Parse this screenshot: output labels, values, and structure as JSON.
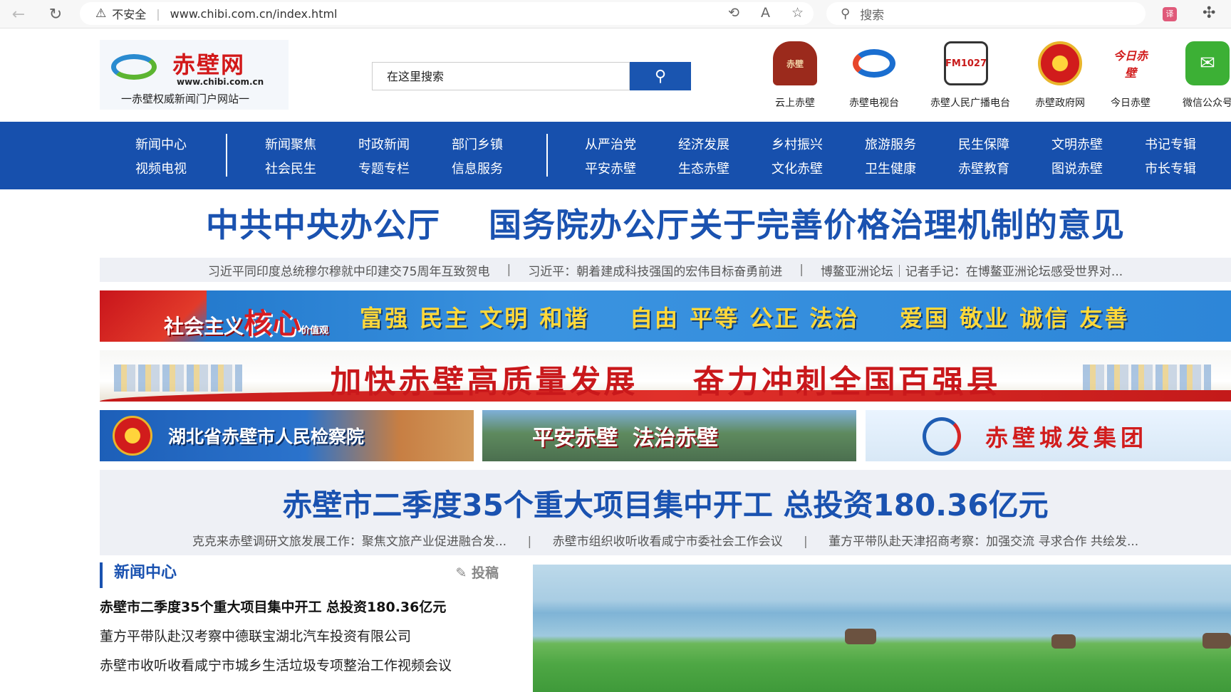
{
  "browser": {
    "security_label": "不安全",
    "url": "www.chibi.com.cn/index.html",
    "search_placeholder": "搜索"
  },
  "header": {
    "brand": "赤壁网",
    "domain": "www.chibi.com.cn",
    "slogan": "一赤壁权威新闻门户网站一",
    "search_placeholder": "在这里搜索",
    "quick_links": [
      {
        "label": "云上赤壁",
        "icon": "cloud-chibi-icon"
      },
      {
        "label": "赤壁电视台",
        "icon": "tv-station-icon"
      },
      {
        "label": "赤壁人民广播电台",
        "icon": "radio-fm1027-icon"
      },
      {
        "label": "赤壁政府网",
        "icon": "national-emblem-icon"
      },
      {
        "label": "今日赤壁",
        "icon": "today-chibi-icon"
      },
      {
        "label": "微信公众号",
        "icon": "wechat-icon"
      }
    ]
  },
  "nav": {
    "groups": [
      [
        [
          "新闻中心",
          "视频电视"
        ]
      ],
      [
        [
          "新闻聚焦",
          "社会民生"
        ],
        [
          "时政新闻",
          "专题专栏"
        ],
        [
          "部门乡镇",
          "信息服务"
        ]
      ],
      [
        [
          "从严治党",
          "平安赤壁"
        ],
        [
          "经济发展",
          "生态赤壁"
        ],
        [
          "乡村振兴",
          "文化赤壁"
        ],
        [
          "旅游服务",
          "卫生健康"
        ],
        [
          "民生保障",
          "赤壁教育"
        ],
        [
          "文明赤壁",
          "图说赤壁"
        ],
        [
          "书记专辑",
          "市长专辑"
        ]
      ]
    ]
  },
  "headline": {
    "title": "中共中央办公厅    国务院办公厅关于完善价格治理机制的意见",
    "links": [
      "习近平同印度总统穆尔穆就中印建交75周年互致贺电",
      "习近平：朝着建成科技强国的宏伟目标奋勇前进",
      "博鳌亚洲论坛｜记者手记：在博鳌亚洲论坛感受世界对..."
    ]
  },
  "banners": {
    "values_left": "社会主义",
    "values_core": "核心",
    "values_small": "价值观",
    "values_main": "富强 民主 文明 和谐    自由 平等 公正 法治    爱国 敬业 诚信 友善",
    "development": "加快赤壁高质量发展    奋力冲刺全国百强县",
    "ads": [
      "湖北省赤壁市人民检察院",
      "平安赤壁  法治赤壁",
      "赤壁城发集团"
    ]
  },
  "feature": {
    "title": "赤壁市二季度35个重大项目集中开工 总投资180.36亿元",
    "links": [
      "克克来赤壁调研文旅发展工作：聚焦文旅产业促进融合发...",
      "赤壁市组织收听收看咸宁市委社会工作会议",
      "董方平带队赴天津招商考察：加强交流 寻求合作 共绘发..."
    ]
  },
  "news": {
    "heading": "新闻中心",
    "submit_label": "投稿",
    "items": [
      "赤壁市二季度35个重大项目集中开工 总投资180.36亿元",
      "董方平带队赴汉考察中德联宝湖北汽车投资有限公司",
      "赤壁市收听收看咸宁市城乡生活垃圾专项整治工作视频会议"
    ]
  },
  "colors": {
    "primary_blue": "#1750ad",
    "headline_blue": "#1a52b0",
    "banner_red": "#c9181b"
  }
}
